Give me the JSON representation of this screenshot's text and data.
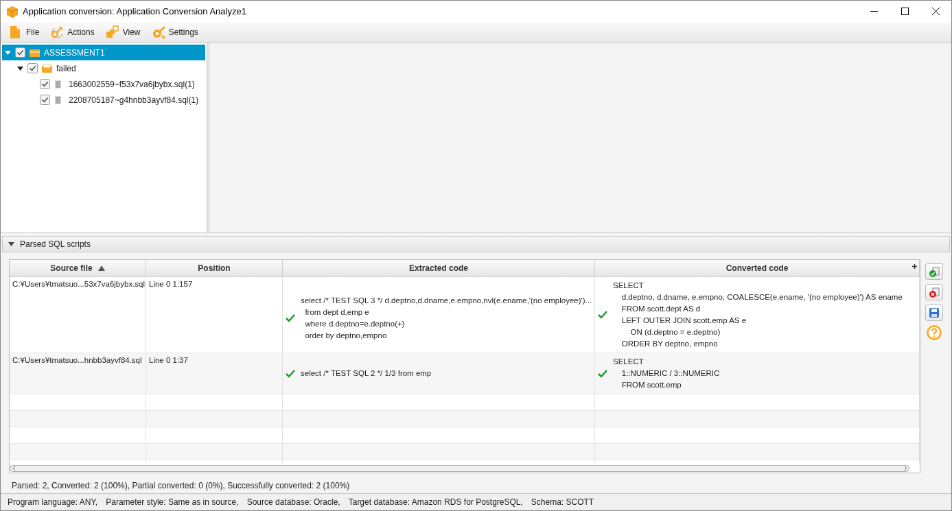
{
  "window": {
    "title": "Application conversion: Application Conversion Analyze1"
  },
  "menu": [
    {
      "label": "File",
      "kind": "file"
    },
    {
      "label": "Actions",
      "kind": "actions"
    },
    {
      "label": "View",
      "kind": "view"
    },
    {
      "label": "Settings",
      "kind": "settings"
    }
  ],
  "tree": [
    {
      "label": "ASSESSMENT1",
      "kind": "root",
      "checked": true,
      "expanded": true,
      "selected": true,
      "children": [
        {
          "label": "failed",
          "kind": "folder",
          "checked": true,
          "expanded": true,
          "selected": false,
          "children": [
            {
              "label": "1663002559~f53x7va6jbybx.sql(1)",
              "kind": "file",
              "checked": true,
              "selected": false
            },
            {
              "label": "2208705187~g4hnbb3ayvf84.sql(1)",
              "kind": "file",
              "checked": true,
              "selected": false
            }
          ]
        }
      ]
    }
  ],
  "results_panel": {
    "title": "Parsed SQL scripts",
    "expanded": true
  },
  "table": {
    "columns": [
      {
        "label": "Source file",
        "sorted_ascending": true
      },
      {
        "label": "Position"
      },
      {
        "label": "Extracted code"
      },
      {
        "label": "Converted code"
      }
    ],
    "rows": [
      {
        "source_file": "C:¥Users¥tmatsuo...53x7va6jbybx.sql",
        "position": "Line 0 1:157",
        "extracted_ok": true,
        "extracted_code": [
          "select /* TEST SQL 3 */ d.deptno,d.dname,e.empno,nvl(e.ename,'(no employee)')...",
          "  from dept d,emp e",
          "  where d.deptno=e.deptno(+)",
          "  order by deptno,empno"
        ],
        "converted_ok": true,
        "converted_code": [
          "SELECT",
          "    d.deptno, d.dname, e.empno, COALESCE(e.ename, '(no employee)') AS ename",
          "    FROM scott.dept AS d",
          "    LEFT OUTER JOIN scott.emp AS e",
          "        ON (d.deptno = e.deptno)",
          "    ORDER BY deptno, empno"
        ]
      },
      {
        "source_file": "C:¥Users¥tmatsuo...hnbb3ayvf84.sql",
        "position": "Line 0 1:37",
        "extracted_ok": true,
        "extracted_code": [
          "select /* TEST SQL 2 */ 1/3 from emp"
        ],
        "converted_ok": true,
        "converted_code": [
          "SELECT",
          "    1::NUMERIC / 3::NUMERIC",
          "    FROM scott.emp"
        ]
      }
    ]
  },
  "summary": "Parsed: 2, Converted: 2 (100%), Partial converted: 0 (0%), Successfully converted: 2 (100%)",
  "status_bar": [
    "Program language: ANY,",
    "Parameter style: Same as in source,",
    "Source database: Oracle,",
    "Target database: Amazon RDS for PostgreSQL,",
    "Schema: SCOTT"
  ]
}
